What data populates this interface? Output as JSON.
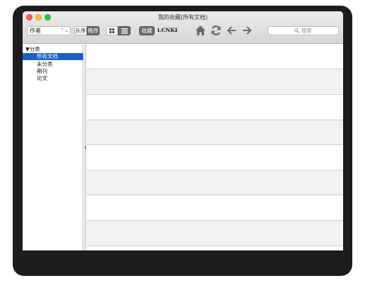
{
  "window": {
    "title": "我的收藏(所有文档)"
  },
  "toolbar": {
    "sort_field": "作者",
    "ascending_label": "升序",
    "descending_label": "降序",
    "favorites_label": "收藏",
    "cnki_label": "i.CNKI",
    "search_placeholder": "搜索",
    "icons": [
      "home-icon",
      "refresh-icon",
      "back-arrow-icon",
      "forward-arrow-icon",
      "search-icon",
      "grid-view-icon",
      "list-view-icon"
    ]
  },
  "sidebar": {
    "group_label": "▼分类",
    "items": [
      {
        "label": "所有文档",
        "selected": true
      },
      {
        "label": "未分类",
        "selected": false
      },
      {
        "label": "期刊",
        "selected": false
      },
      {
        "label": "论文",
        "selected": false
      }
    ]
  },
  "colors": {
    "selection": "#1f5ec6",
    "active_segment": "#6b6b6b",
    "row_alt": "#f1f1f1"
  }
}
